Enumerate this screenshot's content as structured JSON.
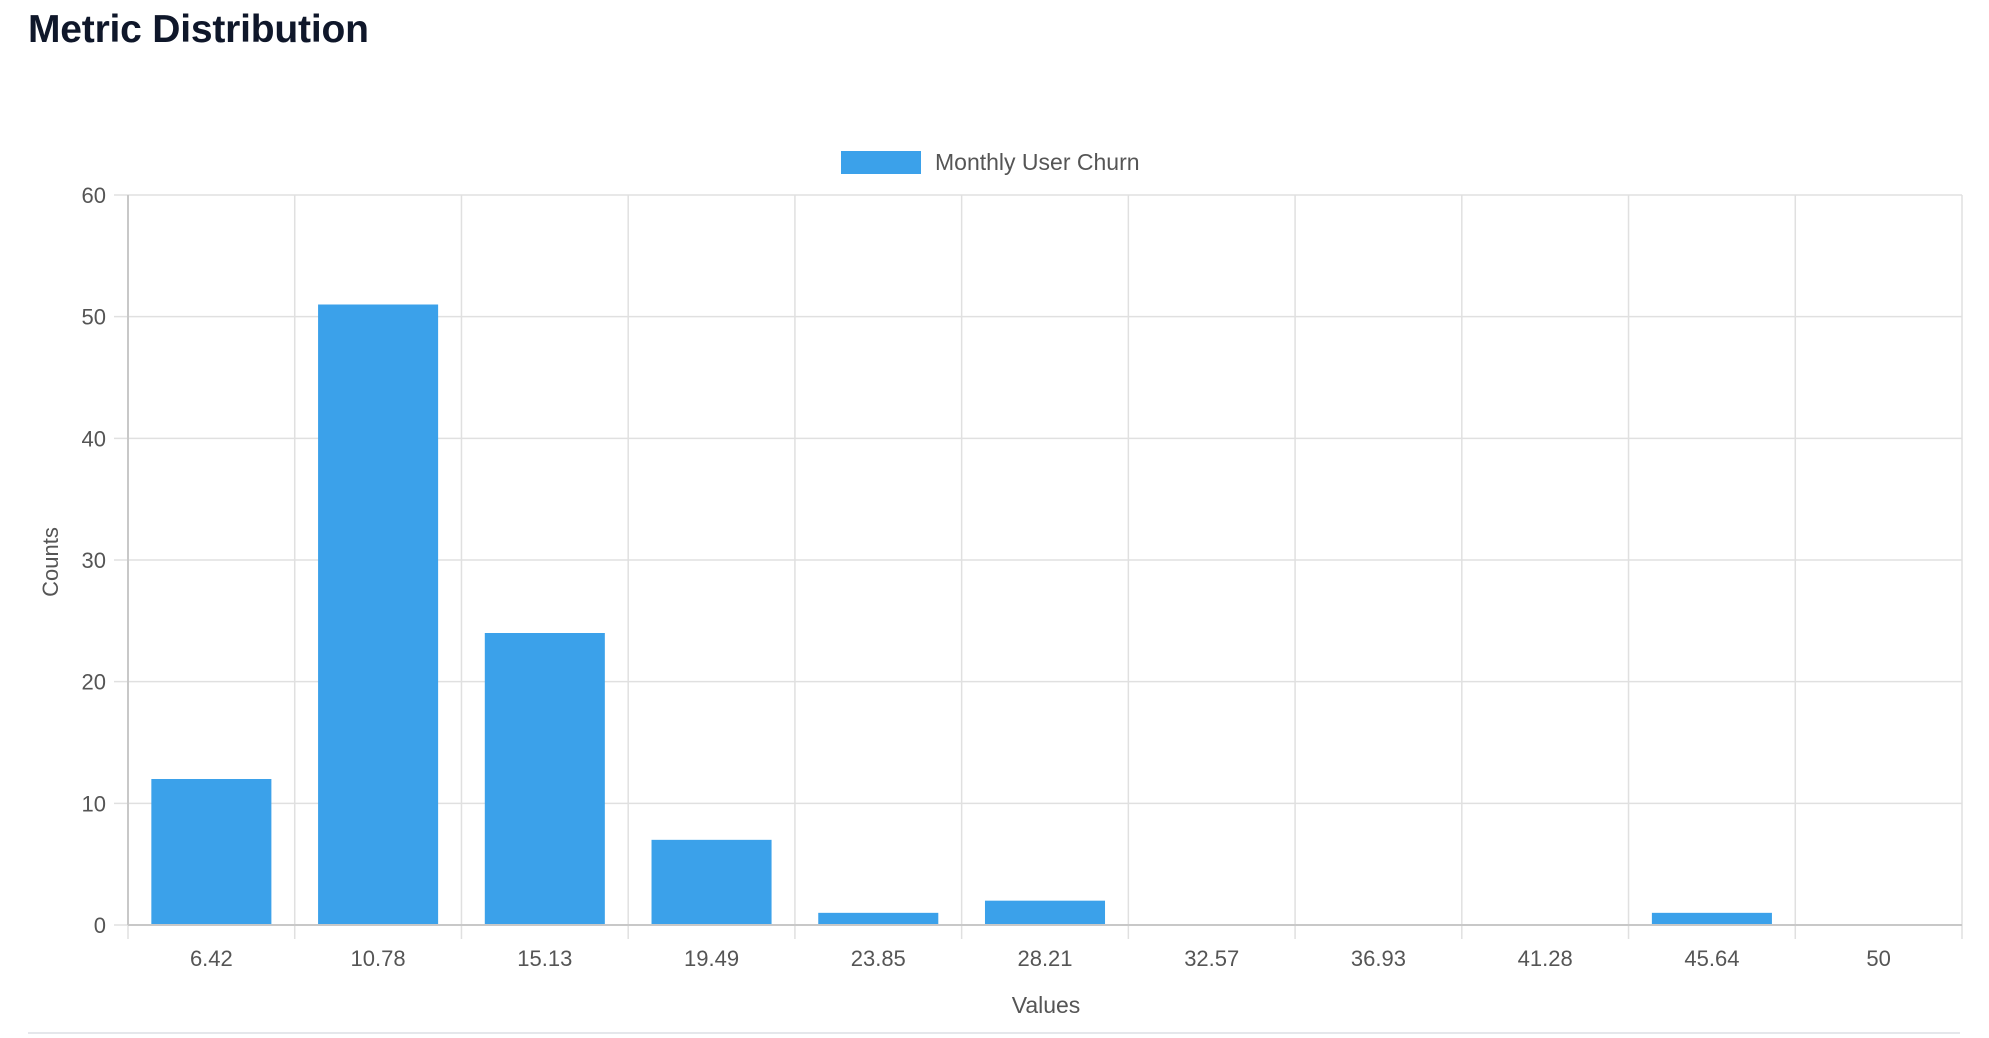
{
  "page": {
    "title": "Metric Distribution"
  },
  "chart_data": {
    "type": "bar",
    "categories": [
      "6.42",
      "10.78",
      "15.13",
      "19.49",
      "23.85",
      "28.21",
      "32.57",
      "36.93",
      "41.28",
      "45.64",
      "50"
    ],
    "series": [
      {
        "name": "Monthly User Churn",
        "values": [
          12,
          51,
          24,
          7,
          1,
          2,
          0,
          0,
          0,
          1,
          0
        ],
        "color": "#3ba1ea"
      }
    ],
    "xlabel": "Values",
    "ylabel": "Counts",
    "ylim": [
      0,
      60
    ],
    "yticks": [
      "0",
      "10",
      "20",
      "30",
      "40",
      "50",
      "60"
    ],
    "grid": true,
    "legend_position": "top-center"
  },
  "colors": {
    "bar": "#3ba1ea",
    "grid": "#e0e0e0",
    "axis": "#c8c8c8",
    "text": "#555555",
    "title": "#0f172a"
  }
}
